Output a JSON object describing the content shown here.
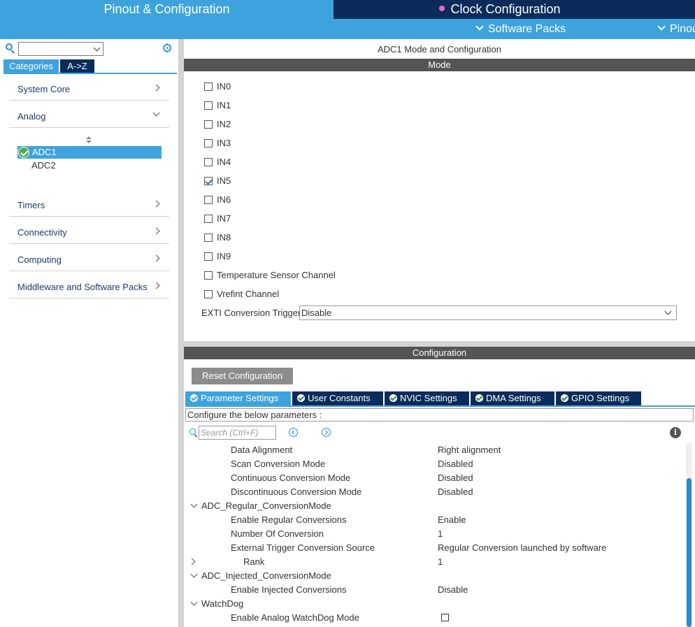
{
  "top_tabs": {
    "pinout": "Pinout & Configuration",
    "clock": "Clock Configuration"
  },
  "sub_menu": {
    "software_packs": "Software Packs",
    "pinout": "Pinout"
  },
  "left_panel": {
    "category_tabs": [
      "Categories",
      "A->Z"
    ],
    "categories": [
      "System Core",
      "Analog",
      "Timers",
      "Connectivity",
      "Computing",
      "Middleware and Software Packs"
    ],
    "analog_items": [
      "ADC1",
      "ADC2"
    ]
  },
  "mode": {
    "title": "ADC1 Mode and Configuration",
    "header": "Mode",
    "channels": [
      {
        "label": "IN0",
        "checked": false
      },
      {
        "label": "IN1",
        "checked": false
      },
      {
        "label": "IN2",
        "checked": false
      },
      {
        "label": "IN3",
        "checked": false
      },
      {
        "label": "IN4",
        "checked": false
      },
      {
        "label": "IN5",
        "checked": true
      },
      {
        "label": "IN6",
        "checked": false
      },
      {
        "label": "IN7",
        "checked": false
      },
      {
        "label": "IN8",
        "checked": false
      },
      {
        "label": "IN9",
        "checked": false
      },
      {
        "label": "Temperature Sensor Channel",
        "checked": false
      },
      {
        "label": "Vrefint Channel",
        "checked": false
      }
    ],
    "exti_label": "EXTI Conversion Trigger",
    "exti_value": "Disable"
  },
  "configuration": {
    "header": "Configuration",
    "reset_label": "Reset Configuration",
    "tabs": [
      "Parameter Settings",
      "User Constants",
      "NVIC Settings",
      "DMA Settings",
      "GPIO Settings"
    ],
    "hint": "Configure the below parameters :",
    "search_placeholder": "Search (Ctrl+F)",
    "params": [
      {
        "name": "Data Alignment",
        "value": "Right alignment",
        "kind": "param"
      },
      {
        "name": "Scan Conversion Mode",
        "value": "Disabled",
        "kind": "param"
      },
      {
        "name": "Continuous Conversion Mode",
        "value": "Disabled",
        "kind": "param"
      },
      {
        "name": "Discontinuous Conversion Mode",
        "value": "Disabled",
        "kind": "param"
      },
      {
        "name": "ADC_Regular_ConversionMode",
        "value": "",
        "kind": "group"
      },
      {
        "name": "Enable Regular Conversions",
        "value": "Enable",
        "kind": "param"
      },
      {
        "name": "Number Of Conversion",
        "value": "1",
        "kind": "param"
      },
      {
        "name": "External Trigger Conversion Source",
        "value": "Regular Conversion launched by software",
        "kind": "param"
      },
      {
        "name": "Rank",
        "value": "1",
        "kind": "subgroup"
      },
      {
        "name": "ADC_Injected_ConversionMode",
        "value": "",
        "kind": "group"
      },
      {
        "name": "Enable Injected Conversions",
        "value": "Disable",
        "kind": "param"
      },
      {
        "name": "WatchDog",
        "value": "",
        "kind": "group"
      },
      {
        "name": "Enable Analog WatchDog Mode",
        "value": "",
        "kind": "checkbox"
      }
    ]
  },
  "colors": {
    "accent": "#3ea3dc",
    "dark": "#0b2c5a",
    "header_bar": "#545454"
  }
}
